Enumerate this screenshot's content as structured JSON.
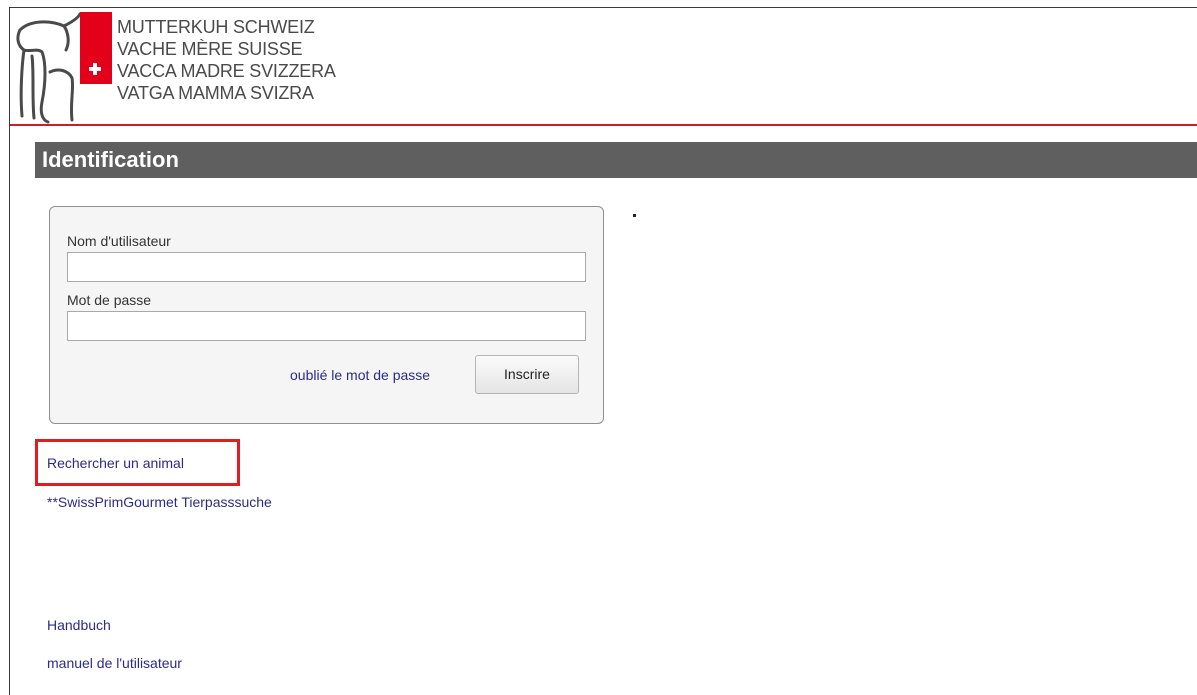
{
  "header": {
    "logo_icon": "cow-and-calf-icon",
    "flag_icon": "swiss-flag-icon",
    "org_names": [
      "MUTTERKUH SCHWEIZ",
      "VACHE MÈRE SUISSE",
      "VACCA MADRE SVIZZERA",
      "VATGA MAMMA SVIZRA"
    ],
    "accent_color": "#d21a2a"
  },
  "title": "Identification",
  "login": {
    "username_label": "Nom d'utilisateur",
    "username_value": "",
    "password_label": "Mot de passe",
    "password_value": "",
    "forgot_label": "oublié le mot de passe",
    "submit_label": "Inscrire"
  },
  "links": {
    "search_animal": "Rechercher un animal",
    "swissprim": "**SwissPrimGourmet Tierpasssuche",
    "handbuch": "Handbuch",
    "manual": "manuel de l'utilisateur"
  },
  "highlight_color": "#e31b23"
}
